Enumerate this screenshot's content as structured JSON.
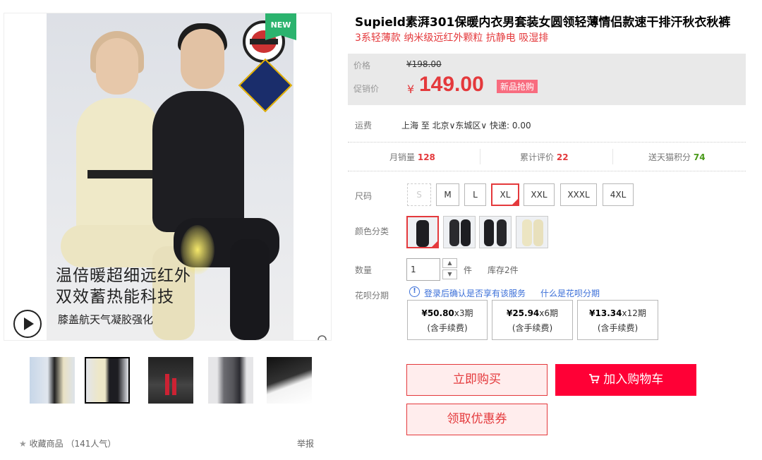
{
  "gallery": {
    "new_tag": "NEW",
    "promo_line1": "温倍暖超细远红外",
    "promo_line2": "双效蓄热能科技",
    "promo_line3": "膝盖航天气凝胶强化",
    "play_icon": "play-icon",
    "zoom_icon": "magnifier-icon",
    "thumbnails": [
      "thumb-1",
      "thumb-2",
      "thumb-3",
      "thumb-4",
      "thumb-5"
    ],
    "selected_thumbnail": "thumb-2"
  },
  "footer": {
    "favorite_label": "收藏商品",
    "favorite_count": "（141人气）",
    "report_label": "举报"
  },
  "product": {
    "title": "Supield素湃301保暖内衣男套装女圆领轻薄情侣款速干排汗秋衣秋裤",
    "subtitle": "3系轻薄款 纳米级远红外颗粒 抗静电 吸湿排"
  },
  "price": {
    "price_label": "价格",
    "original_price": "¥198.00",
    "promo_label": "促销价",
    "currency": "¥",
    "promo_price": "149.00",
    "badge": "新品抢购"
  },
  "shipping": {
    "label": "运费",
    "value": "上海 至 北京∨东城区∨ 快递: 0.00"
  },
  "stats": {
    "monthly_sales_label": "月销量",
    "monthly_sales": "128",
    "reviews_label": "累计评价",
    "reviews": "22",
    "points_label": "送天猫积分",
    "points": "74"
  },
  "sizes": {
    "label": "尺码",
    "options": [
      "S",
      "M",
      "L",
      "XL",
      "XXL",
      "XXXL",
      "4XL"
    ],
    "selected": "XL",
    "disabled": [
      "S"
    ]
  },
  "colors": {
    "label": "颜色分类",
    "options": [
      "color-1",
      "color-2",
      "color-3",
      "color-4"
    ],
    "selected": "color-1"
  },
  "quantity": {
    "label": "数量",
    "value": "1",
    "unit": "件",
    "stock": "库存2件"
  },
  "huabei": {
    "label": "花呗分期",
    "info_icon": "info-icon",
    "login_link": "登录",
    "middle_text": "后确认是否享有该服务",
    "what_link": "什么是花呗分期",
    "plans": [
      {
        "amount": "¥50.80",
        "term": "x3期",
        "fee": "(含手续费)"
      },
      {
        "amount": "¥25.94",
        "term": "x6期",
        "fee": "(含手续费)"
      },
      {
        "amount": "¥13.34",
        "term": "x12期",
        "fee": "(含手续费)"
      }
    ]
  },
  "actions": {
    "buy_now": "立即购买",
    "add_to_cart": "加入购物车",
    "coupon": "领取优惠券"
  },
  "colors_theme": {
    "accent_red": "#e4393c",
    "cart_red": "#ff0036",
    "link_blue": "#3b6fd8",
    "points_green": "#4a9a1a"
  }
}
